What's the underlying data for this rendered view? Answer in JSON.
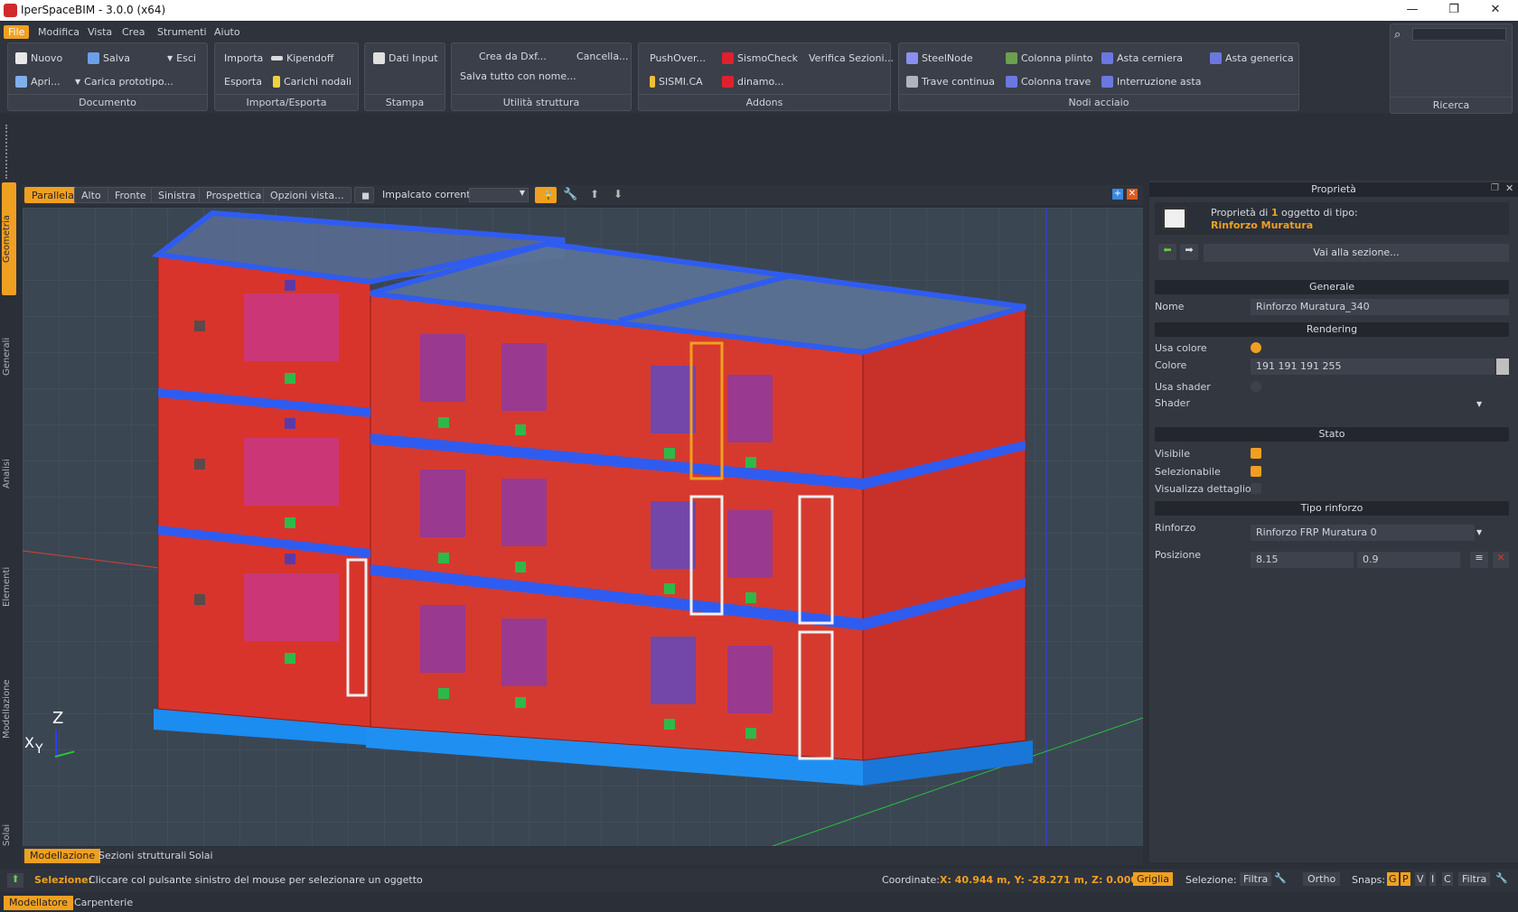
{
  "app": {
    "title": "IperSpaceBIM - 3.0.0 (x64)"
  },
  "window": {
    "minimize": "—",
    "restore": "❐",
    "close": "✕"
  },
  "menu": [
    "File",
    "Modifica",
    "Vista",
    "Crea",
    "Strumenti",
    "Aiuto"
  ],
  "ribbon": {
    "documento": {
      "label": "Documento",
      "nuovo": "Nuovo",
      "salva": "Salva",
      "esci": "Esci",
      "apri": "Apri...",
      "carica": "Carica prototipo..."
    },
    "importa": {
      "label": "Importa/Esporta",
      "importa": "Importa",
      "kipendoff": "Kipendoff",
      "esporta": "Esporta",
      "carichi": "Carichi nodali"
    },
    "stampa": {
      "label": "Stampa",
      "dati": "Dati Input"
    },
    "utilita": {
      "label": "Utilità struttura",
      "dxf": "Crea da Dxf...",
      "cancella": "Cancella...",
      "salva_tutto": "Salva tutto con nome..."
    },
    "addons": {
      "label": "Addons",
      "pushover": "PushOver...",
      "sismocheck": "SismoCheck",
      "verifica": "Verifica Sezioni...",
      "sismica": "SISMI.CA",
      "dinamo": "dinamo..."
    },
    "nodi": {
      "label": "Nodi acciaio",
      "steelnode": "SteelNode",
      "colonna_plinto": "Colonna plinto",
      "asta_cerniera": "Asta cerniera",
      "asta_generica": "Asta generica",
      "trave_continua": "Trave continua",
      "colonna_trave": "Colonna trave",
      "interruzione": "Interruzione asta"
    },
    "ricerca": {
      "label": "Ricerca"
    }
  },
  "left_tabs": [
    "Geometria",
    "Generali",
    "Analisi",
    "Elementi",
    "Modellazione",
    "Solai"
  ],
  "view_toolbar": {
    "parallela": "Parallela",
    "alto": "Alto",
    "fronte": "Fronte",
    "sinistra": "Sinistra",
    "prospettica": "Prospettica",
    "opzioni": "Opzioni vista...",
    "impalcato": "Impalcato corrente:"
  },
  "axes": {
    "z": "Z",
    "x": "X",
    "y": "Y"
  },
  "bottom_tabs": [
    "Modellazione",
    "Sezioni strutturali",
    "Solai"
  ],
  "status": {
    "label": "Selezione:",
    "message": "Cliccare col pulsante sinistro del mouse per selezionare un oggetto",
    "coord_label": "Coordinate:",
    "coords": "X: 40.944 m, Y: -28.271 m, Z: 0.000 m",
    "griglia": "Griglia",
    "selezione": "Selezione:",
    "filtra": "Filtra",
    "ortho": "Ortho",
    "snaps": "Snaps:",
    "snap_g": "G",
    "snap_p": "P",
    "snap_v": "V",
    "snap_i": "I",
    "snap_c": "C",
    "filtra2": "Filtra"
  },
  "footer_tabs": [
    "Modellatore",
    "Carpenterie"
  ],
  "properties": {
    "title": "Proprietà",
    "desc_prefix": "Proprietà di ",
    "count": "1",
    "desc_suffix": " oggetto di tipo:",
    "type": "Rinforzo Muratura",
    "goto": "Vai alla sezione...",
    "generale": "Generale",
    "nome_label": "Nome",
    "nome": "Rinforzo Muratura_340",
    "rendering": "Rendering",
    "usa_colore": "Usa colore",
    "colore_label": "Colore",
    "colore": "191 191 191 255",
    "usa_shader": "Usa shader",
    "shader": "Shader",
    "stato": "Stato",
    "visibile": "Visibile",
    "selezionabile": "Selezionabile",
    "dettaglio": "Visualizza dettaglio",
    "tipo": "Tipo rinforzo",
    "rinforzo_label": "Rinforzo",
    "rinforzo": "Rinforzo FRP Muratura 0",
    "posizione_label": "Posizione",
    "pos1": "8.15",
    "pos2": "0.9"
  },
  "colors": {
    "accent": "#f0a020",
    "wall": "#d8342c",
    "slab": "#2f6cf0",
    "foundation": "#1b8cf0"
  }
}
